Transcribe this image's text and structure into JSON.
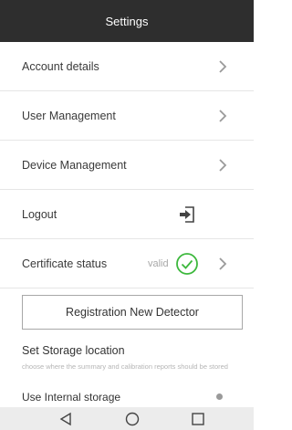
{
  "header": {
    "title": "Settings"
  },
  "menu": {
    "account": "Account details",
    "user_management": "User Management",
    "device_management": "Device Management",
    "logout": "Logout",
    "certificate": "Certificate status",
    "certificate_value": "valid"
  },
  "registration_button": "Registration New Detector",
  "storage": {
    "title": "Set Storage location",
    "description": "choose where the summary and calibration reports should be stored",
    "option": "Use Internal storage"
  },
  "colors": {
    "header_bg": "#2e2e2e",
    "valid_green": "#3db83d",
    "chevron": "#9a9a9a",
    "nav_bg": "#ececec"
  },
  "icons": {
    "chevron": "chevron-right-icon",
    "logout": "logout-icon",
    "valid": "check-circle-icon",
    "nav_back": "back-triangle-icon",
    "nav_home": "home-circle-icon",
    "nav_recent": "recents-square-icon"
  }
}
